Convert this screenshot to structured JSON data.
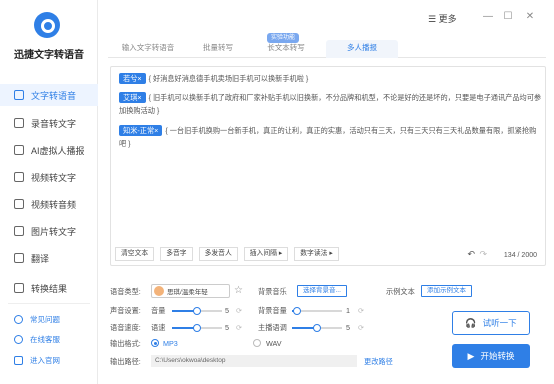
{
  "app": {
    "name": "迅捷文字转语音"
  },
  "sidebar": {
    "items": [
      {
        "label": "文字转语音"
      },
      {
        "label": "录音转文字"
      },
      {
        "label": "AI虚拟人播报"
      },
      {
        "label": "视频转文字"
      },
      {
        "label": "视频转音频"
      },
      {
        "label": "图片转文字"
      },
      {
        "label": "翻译"
      },
      {
        "label": "转换结果"
      }
    ],
    "footer": [
      {
        "label": "常见问题"
      },
      {
        "label": "在线客服"
      },
      {
        "label": "进入官网"
      }
    ]
  },
  "titlebar": {
    "more_label": "更多"
  },
  "tabs": [
    {
      "label": "输入文字转语音"
    },
    {
      "label": "批量转写"
    },
    {
      "label": "长文本转写"
    },
    {
      "label": "多人播报"
    }
  ],
  "tab_badge": "实验功能",
  "editor": {
    "paragraphs": [
      {
        "voice": "若兮×",
        "text": "{ 好消息好消息德手机卖场旧手机可以换新手机啦 }"
      },
      {
        "voice": "艾琪×",
        "text": "{ 旧手机可以换新手机了政府和厂家补贴手机以旧换新，不分品牌和机型，不论是好的还是坏的，只要是电子通讯产品均可参加换购活动 }"
      },
      {
        "voice": "知米-正常×",
        "text": "{ 一台旧手机换购一台新手机，真正的让利，真正的实惠，活动只有三天，只有三天只有三天礼品数量有限，抓紧抢购吧 }"
      }
    ],
    "tools": [
      "清空文本",
      "多音字",
      "多发音人",
      "插入间隔 ▸",
      "数字读法 ▸"
    ],
    "counter": "134 / 2000"
  },
  "settings": {
    "voice_type_label": "语音类型:",
    "voice_name": "思琪/温柔年轻",
    "bg_music_label": "背景音乐",
    "bg_music_button": "选择背景音...",
    "sample_label": "示例文本",
    "sample_button": "添加示例文本",
    "volume_label": "声音设置:",
    "volume_sub": "音量",
    "volume_value": "5",
    "volume_level": 0.5,
    "bg_volume_label": "背景音量",
    "bg_volume_value": "1",
    "bg_volume_level": 0.1,
    "speed_label": "语音速度:",
    "speed_sub": "语速",
    "speed_value": "5",
    "speed_level": 0.5,
    "pitch_label": "主播语调",
    "pitch_value": "5",
    "pitch_level": 0.5,
    "format_label": "输出格式:",
    "format_mp3": "MP3",
    "format_wav": "WAV",
    "path_label": "输出路径:",
    "path_value": "C:\\Users\\okwoa\\desktop",
    "change_path": "更改路径",
    "listen_button": "试听一下",
    "start_button": "开始转换"
  },
  "colors": {
    "accent": "#2f7fe6"
  }
}
